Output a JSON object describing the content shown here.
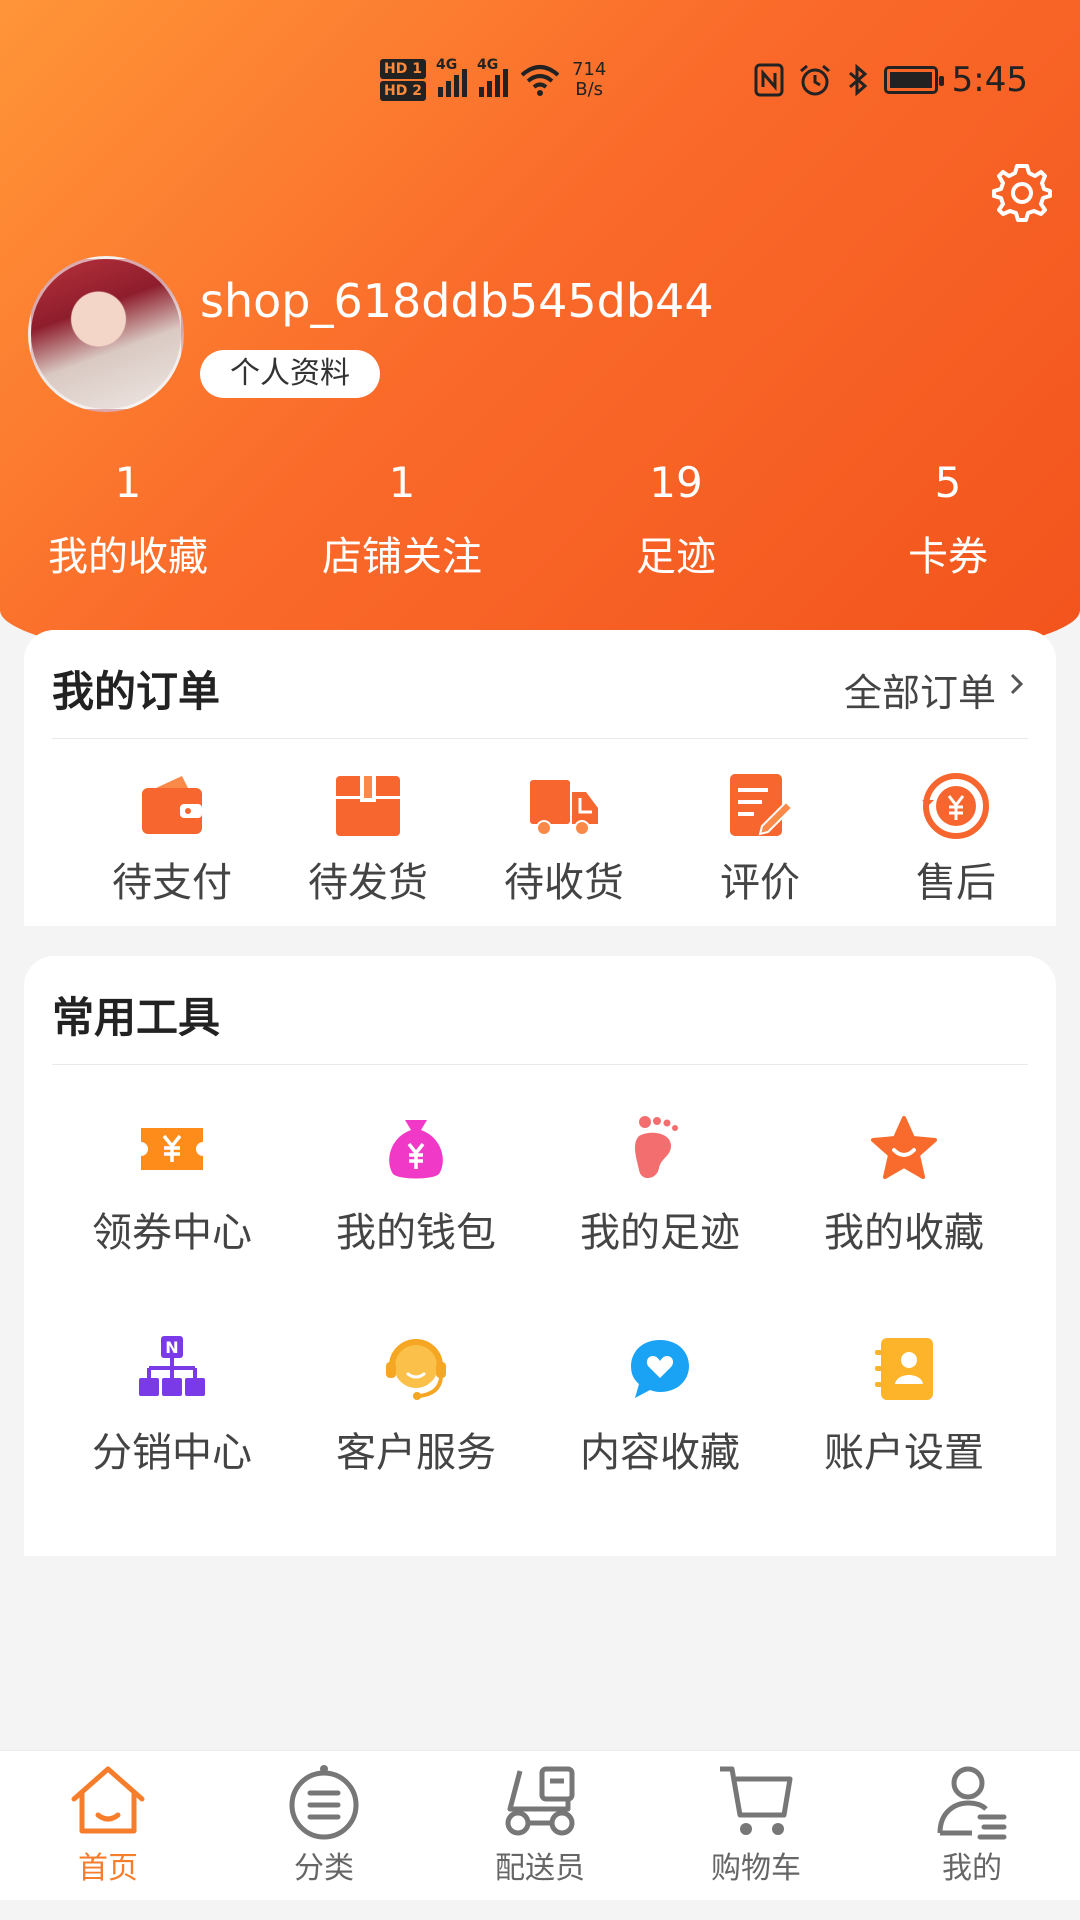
{
  "status_bar": {
    "sim1": "HD 1",
    "sim2": "HD 2",
    "network": "4G",
    "speed_value": "714",
    "speed_unit": "B/s",
    "time": "5:45",
    "icons": [
      "nfc-icon",
      "alarm-icon",
      "bluetooth-icon",
      "battery-icon"
    ]
  },
  "profile": {
    "username": "shop_618ddb545db44",
    "profile_button": "个人资料",
    "settings_icon": "gear-icon"
  },
  "stats": [
    {
      "value": "1",
      "label": "我的收藏"
    },
    {
      "value": "1",
      "label": "店铺关注"
    },
    {
      "value": "19",
      "label": "足迹"
    },
    {
      "value": "5",
      "label": "卡券"
    }
  ],
  "orders": {
    "title": "我的订单",
    "all_orders": "全部订单",
    "items": [
      {
        "label": "待支付",
        "icon": "wallet-icon"
      },
      {
        "label": "待发货",
        "icon": "package-icon"
      },
      {
        "label": "待收货",
        "icon": "truck-icon"
      },
      {
        "label": "评价",
        "icon": "review-edit-icon"
      },
      {
        "label": "售后",
        "icon": "yuan-refund-icon"
      }
    ]
  },
  "tools": {
    "title": "常用工具",
    "items": [
      {
        "label": "领券中心",
        "icon": "coupon-icon"
      },
      {
        "label": "我的钱包",
        "icon": "money-bag-icon"
      },
      {
        "label": "我的足迹",
        "icon": "footprint-icon"
      },
      {
        "label": "我的收藏",
        "icon": "star-icon"
      },
      {
        "label": "分销中心",
        "icon": "distribution-network-icon"
      },
      {
        "label": "客户服务",
        "icon": "headset-icon"
      },
      {
        "label": "内容收藏",
        "icon": "heart-chat-icon"
      },
      {
        "label": "账户设置",
        "icon": "contact-book-icon"
      }
    ]
  },
  "bottom_nav": {
    "active_color": "#f67d2c",
    "items": [
      {
        "label": "首页",
        "icon": "home-icon",
        "active": true
      },
      {
        "label": "分类",
        "icon": "category-icon",
        "active": false
      },
      {
        "label": "配送员",
        "icon": "delivery-scooter-icon",
        "active": false
      },
      {
        "label": "购物车",
        "icon": "cart-icon",
        "active": false
      },
      {
        "label": "我的",
        "icon": "user-icon",
        "active": false
      }
    ]
  },
  "colors": {
    "header_start": "#ff9538",
    "header_end": "#f2531c",
    "accent": "#f67d2c"
  }
}
